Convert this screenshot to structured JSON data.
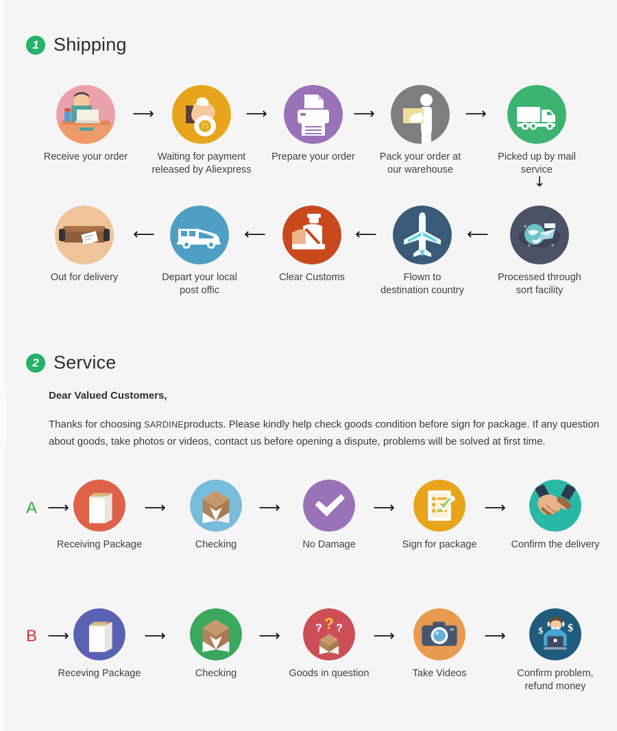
{
  "page": {
    "background": "#f5f5f5",
    "accent_green": "#27b16a"
  },
  "sections": [
    {
      "badge": "1",
      "title": "Shipping"
    },
    {
      "badge": "2",
      "title": "Service"
    }
  ],
  "shipping": {
    "row1": {
      "arrow_glyph": "⟶",
      "steps": [
        {
          "label": "Receive your order",
          "icon": "person-at-desk-icon",
          "color": "#eaa1ab"
        },
        {
          "label": "Waiting for payment\nreleased by Aliexpress",
          "icon": "hand-money-bag-icon",
          "color": "#e8a51c"
        },
        {
          "label": "Prepare your order",
          "icon": "printer-icon",
          "color": "#9a72b8"
        },
        {
          "label": "Pack your order at\nour warehouse",
          "icon": "worker-packing-icon",
          "color": "#7e7e7e"
        },
        {
          "label": "Picked up by mail service",
          "icon": "delivery-truck-icon",
          "color": "#3cb371"
        }
      ]
    },
    "connector_down_glyph": "↓",
    "row2": {
      "arrow_glyph": "⟵",
      "steps": [
        {
          "label": "Out for delivery",
          "icon": "parcel-box-icon",
          "color": "#f0c49a"
        },
        {
          "label": "Depart your local\npost offic",
          "icon": "delivery-van-icon",
          "color": "#4e9fc4"
        },
        {
          "label": "Clear  Customs",
          "icon": "customs-officer-icon",
          "color": "#c9491d"
        },
        {
          "label": "Flown to\ndestination country",
          "icon": "airplane-icon",
          "color": "#3a5a78"
        },
        {
          "label": "Processed through\nsort facility",
          "icon": "global-sorting-icon",
          "color": "#4c5266"
        }
      ]
    }
  },
  "service": {
    "salutation": "Dear Valued Customers,",
    "paragraph_part1": "Thanks for choosing ",
    "paragraph_brand": "SARDINE",
    "paragraph_part2": "products. Please kindly help check goods condition before sign for package. If any question about goods, take photos or videos, contact us before opening a dispute, problems will be solved at first time.",
    "arrow_glyph": "⟶",
    "rows": [
      {
        "letter": "A",
        "letter_color": "#2fae3e",
        "steps": [
          {
            "label": "Receiving Package",
            "icon": "closed-package-icon",
            "color": "#e0614a"
          },
          {
            "label": "Checking",
            "icon": "open-box-icon",
            "color": "#78bcdb"
          },
          {
            "label": "No Damage",
            "icon": "checkmark-icon",
            "color": "#9a72b8"
          },
          {
            "label": "Sign for package",
            "icon": "signed-document-icon",
            "color": "#e8a51c"
          },
          {
            "label": "Confirm the delivery",
            "icon": "handshake-icon",
            "color": "#2ab8a6"
          }
        ]
      },
      {
        "letter": "B",
        "letter_color": "#d8342c",
        "steps": [
          {
            "label": "Receving Package",
            "icon": "closed-package-icon",
            "color": "#5a62b4"
          },
          {
            "label": "Checking",
            "icon": "open-box-icon",
            "color": "#3aa85c"
          },
          {
            "label": "Goods in question",
            "icon": "question-box-icon",
            "color": "#cc4f57"
          },
          {
            "label": "Take Videos",
            "icon": "camera-icon",
            "color": "#e89a50"
          },
          {
            "label": "Confirm problem,\nrefund money",
            "icon": "support-agent-icon",
            "color": "#1f5b7a"
          }
        ]
      }
    ]
  }
}
